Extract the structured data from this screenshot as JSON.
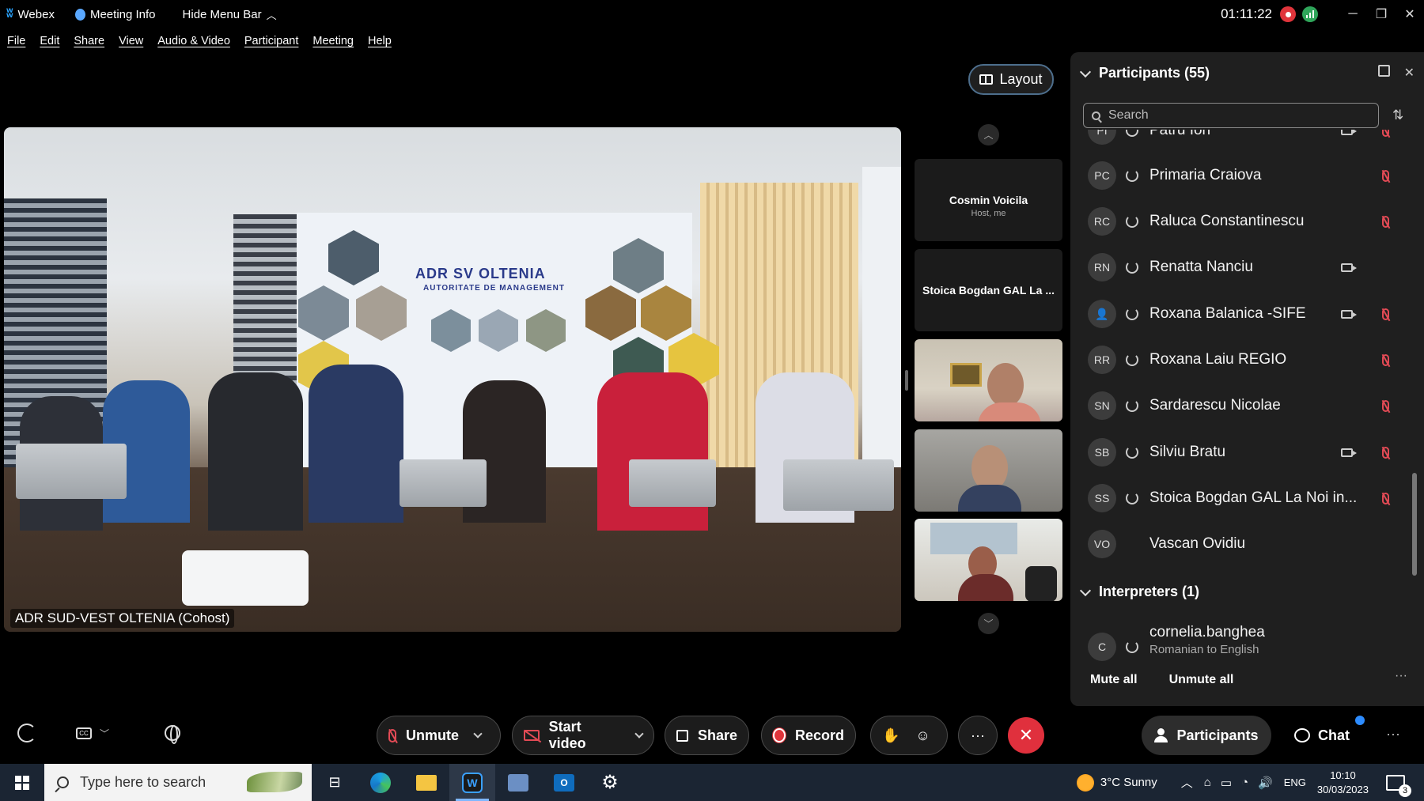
{
  "titlebar": {
    "app_name": "Webex",
    "meeting_info": "Meeting Info",
    "hide_menu_bar": "Hide Menu Bar",
    "timer": "01:11:22"
  },
  "menu": [
    "File",
    "Edit",
    "Share",
    "View",
    "Audio & Video",
    "Participant",
    "Meeting",
    "Help"
  ],
  "layout_button": "Layout",
  "main_video": {
    "label": "ADR SUD-VEST OLTENIA (Cohost)",
    "banner_title": "ADR SV OLTENIA",
    "banner_subtitle": "AUTORITATE DE MANAGEMENT"
  },
  "thumbnails": [
    {
      "name": "Cosmin Voicila",
      "sub": "Host, me"
    },
    {
      "name": "Stoica Bogdan GAL La ..."
    }
  ],
  "participants_panel": {
    "title": "Participants (55)",
    "search_placeholder": "Search",
    "participants": [
      {
        "initials": "PI",
        "name": "Patru Ion",
        "video": true,
        "muted": true
      },
      {
        "initials": "PC",
        "name": "Primaria Craiova",
        "video": false,
        "muted": true
      },
      {
        "initials": "RC",
        "name": "Raluca Constantinescu",
        "video": false,
        "muted": true
      },
      {
        "initials": "RN",
        "name": "Renatta Nanciu",
        "video": true,
        "muted": false
      },
      {
        "initials": "",
        "name": "Roxana Balanica -SIFE",
        "video": true,
        "muted": true,
        "icon": "person-icon"
      },
      {
        "initials": "RR",
        "name": "Roxana Laiu REGIO",
        "video": false,
        "muted": true
      },
      {
        "initials": "SN",
        "name": "Sardarescu Nicolae",
        "video": false,
        "muted": true
      },
      {
        "initials": "SB",
        "name": "Silviu Bratu",
        "video": true,
        "muted": true
      },
      {
        "initials": "SS",
        "name": "Stoica Bogdan GAL La Noi in...",
        "video": false,
        "muted": true
      },
      {
        "initials": "VO",
        "name": "Vascan Ovidiu",
        "video": false,
        "muted": false
      }
    ],
    "interpreters_title": "Interpreters (1)",
    "interpreter": {
      "initials": "C",
      "name": "cornelia.banghea",
      "detail": "Romanian to English"
    },
    "mute_all": "Mute all",
    "unmute_all": "Unmute all"
  },
  "controls": {
    "unmute": "Unmute",
    "start_video": "Start video",
    "share": "Share",
    "record": "Record",
    "participants": "Participants",
    "chat": "Chat"
  },
  "taskbar": {
    "search_placeholder": "Type here to search",
    "weather": "3°C  Sunny",
    "language": "ENG",
    "time": "10:10",
    "date": "30/03/2023",
    "notifications": "3"
  },
  "colors": {
    "accent": "#2d8cff",
    "end_call": "#e0303d",
    "muted": "#e24a55"
  }
}
